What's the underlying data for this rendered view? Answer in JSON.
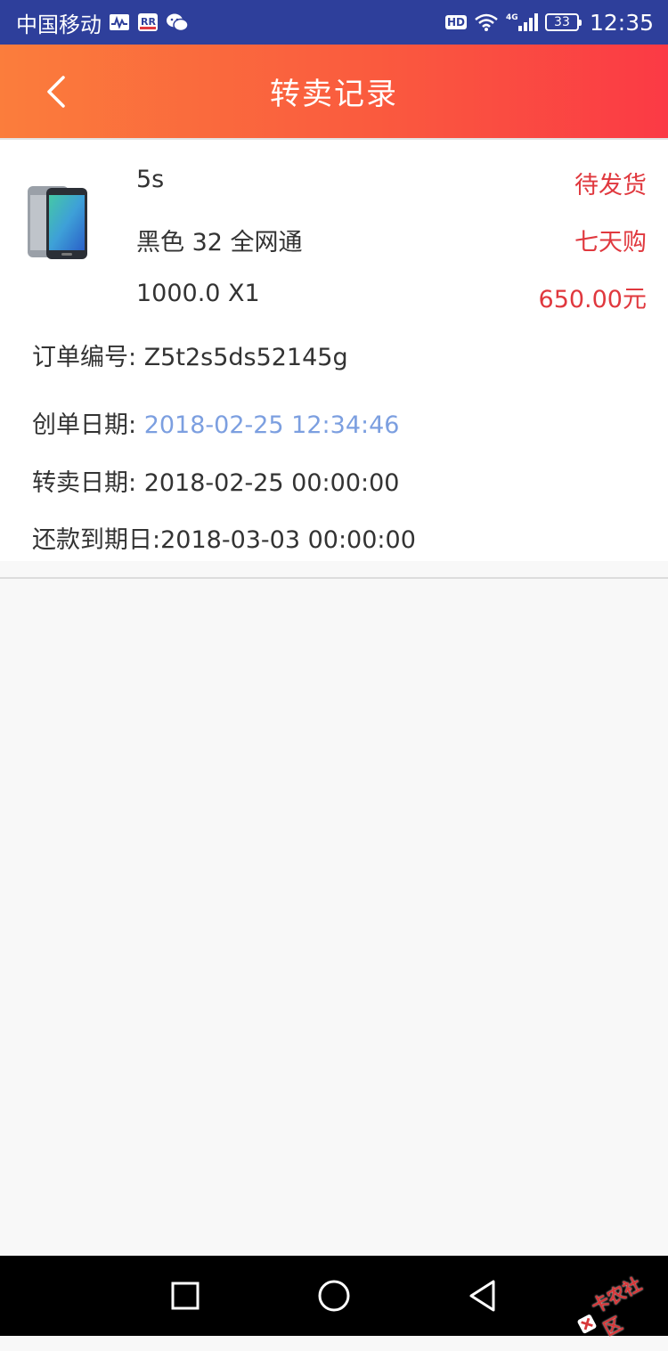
{
  "status_bar": {
    "carrier": "中国移动",
    "network": "4G",
    "hd": "HD",
    "battery": "33",
    "time": "12:35"
  },
  "header": {
    "title": "转卖记录",
    "back_icon": "chevron-left-icon"
  },
  "order": {
    "product_name": "5s",
    "status": "待发货",
    "spec": "黑色 32 全网通",
    "plan": "七天购",
    "price_qty": "1000.0  X1",
    "amount": "650.00元",
    "order_no_label": "订单编号: ",
    "order_no": "Z5t2s5ds52145g",
    "created_label": "创单日期: ",
    "created": "2018-02-25 12:34:46",
    "resale_label": "转卖日期: ",
    "resale": "2018-02-25 00:00:00",
    "due_label": "还款到期日:",
    "due": "2018-03-03 00:00:00"
  },
  "watermark": {
    "text": "卡农社区"
  },
  "colors": {
    "status_bar": "#2e3f9b",
    "header_start": "#fb7d3c",
    "header_end": "#fb3a45",
    "accent_red": "#e0383e",
    "date_blue": "#7c9fe0"
  }
}
